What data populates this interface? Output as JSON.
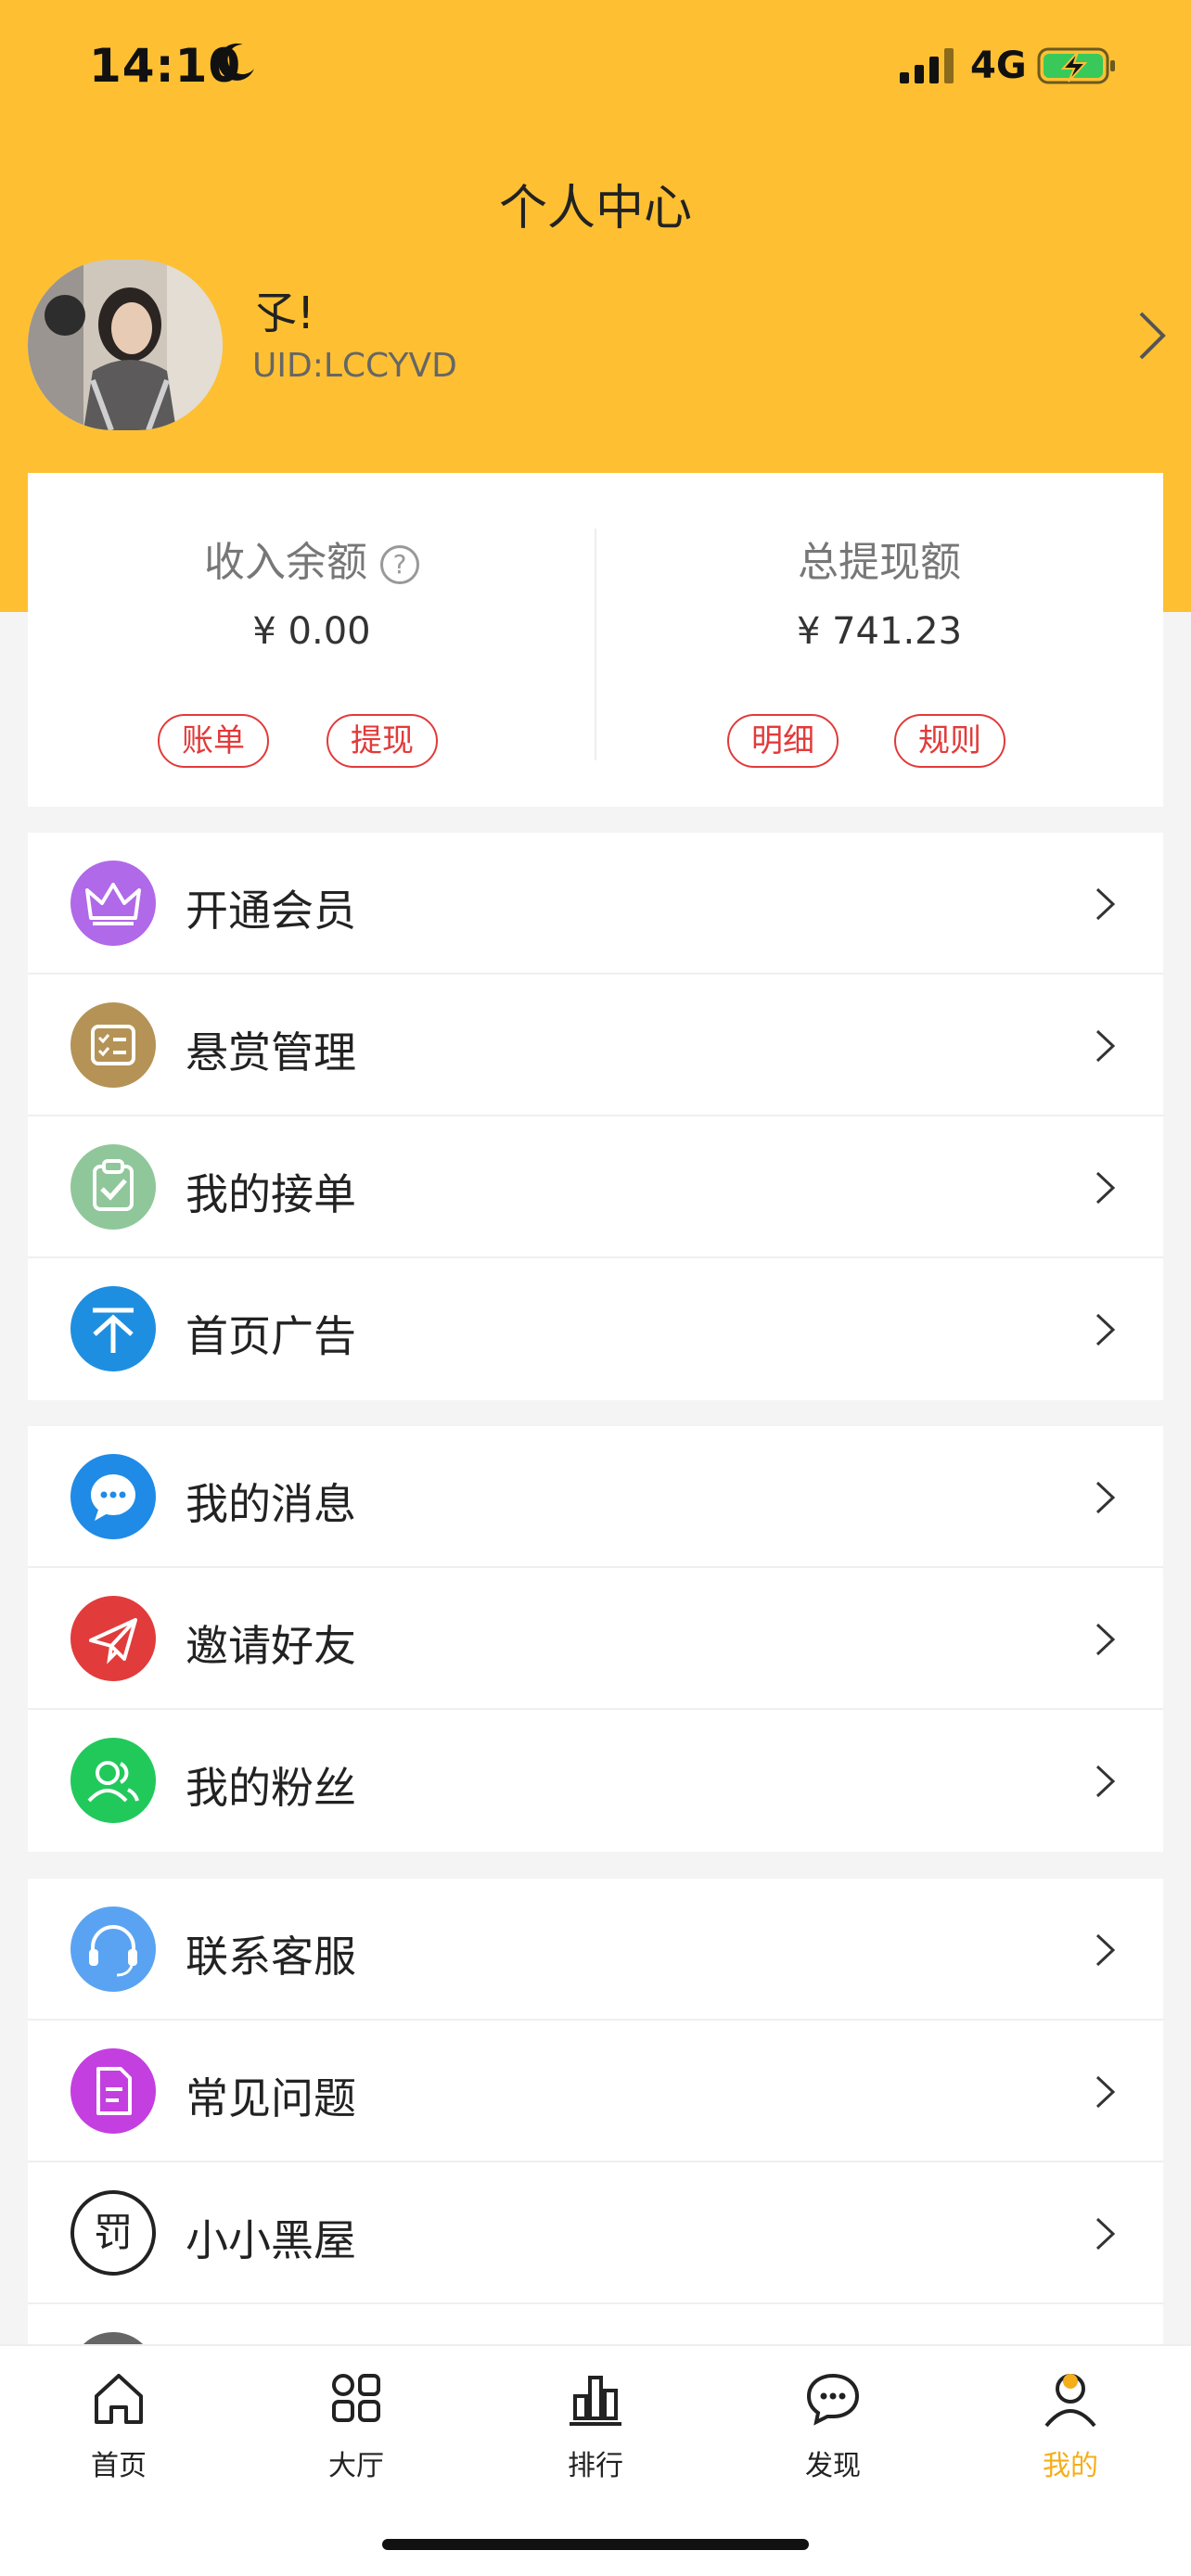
{
  "status_bar": {
    "time": "14:10",
    "network": "4G"
  },
  "header": {
    "title": "个人中心"
  },
  "profile": {
    "nickname": "孓!",
    "uid": "UID:LCCYVD"
  },
  "balance": {
    "income": {
      "title": "收入余额",
      "help_glyph": "?",
      "value": "¥ 0.00",
      "buttons": [
        "账单",
        "提现"
      ]
    },
    "withdrawn": {
      "title": "总提现额",
      "value": "¥ 741.23",
      "buttons": [
        "明细",
        "规则"
      ]
    }
  },
  "menu_groups": [
    [
      {
        "label": "开通会员",
        "icon": "crown-icon",
        "color": "#b069e8"
      },
      {
        "label": "悬赏管理",
        "icon": "checklist-icon",
        "color": "#b59356"
      },
      {
        "label": "我的接单",
        "icon": "clipboard-check-icon",
        "color": "#8fc79a"
      },
      {
        "label": "首页广告",
        "icon": "arrow-up-icon",
        "color": "#1e8fe0"
      }
    ],
    [
      {
        "label": "我的消息",
        "icon": "chat-bubble-icon",
        "color": "#1f8be6"
      },
      {
        "label": "邀请好友",
        "icon": "paper-plane-icon",
        "color": "#e23b3b"
      },
      {
        "label": "我的粉丝",
        "icon": "users-icon",
        "color": "#21c95b"
      }
    ],
    [
      {
        "label": "联系客服",
        "icon": "headset-icon",
        "color": "#5aa3f2"
      },
      {
        "label": "常见问题",
        "icon": "document-icon",
        "color": "#c43fe0"
      },
      {
        "label": "小小黑屋",
        "icon": "penalty-icon",
        "color": "#ffffff"
      }
    ]
  ],
  "tabbar": [
    {
      "label": "首页",
      "icon": "home-icon"
    },
    {
      "label": "大厅",
      "icon": "grid-icon"
    },
    {
      "label": "排行",
      "icon": "bar-chart-icon"
    },
    {
      "label": "发现",
      "icon": "message-icon"
    },
    {
      "label": "我的",
      "icon": "profile-icon",
      "active": true
    }
  ],
  "colors": {
    "header": "#fec032",
    "accent": "#f5ae1b",
    "danger": "#e23a3a"
  }
}
